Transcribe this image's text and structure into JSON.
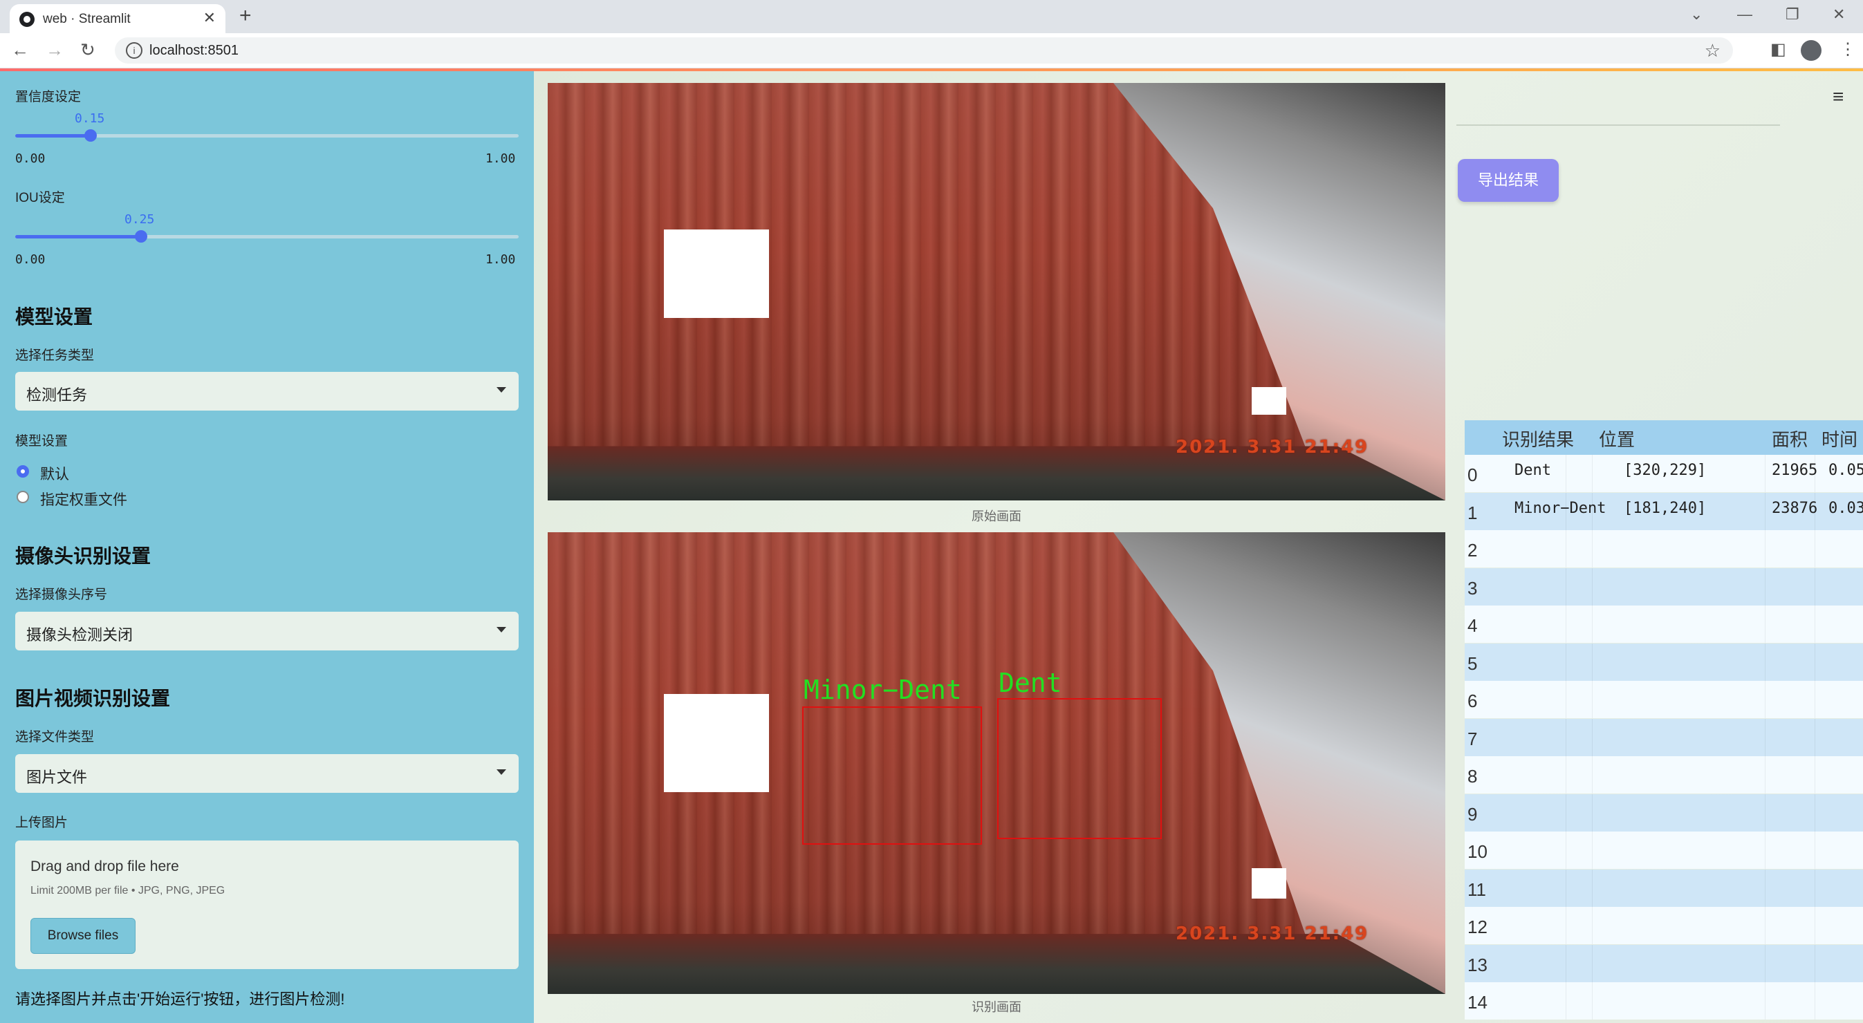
{
  "browser": {
    "tab_title": "web · Streamlit",
    "url": "localhost:8501"
  },
  "sidebar": {
    "confidence": {
      "label": "置信度设定",
      "value": "0.15",
      "min": "0.00",
      "max": "1.00",
      "fraction": 0.15
    },
    "iou": {
      "label": "IOU设定",
      "value": "0.25",
      "min": "0.00",
      "max": "1.00",
      "fraction": 0.25
    },
    "model_section": {
      "title": "模型设置",
      "task_label": "选择任务类型",
      "task_value": "检测任务",
      "model_label": "模型设置",
      "options": [
        "默认",
        "指定权重文件"
      ],
      "selected": 0
    },
    "camera_section": {
      "title": "摄像头识别设置",
      "camera_label": "选择摄像头序号",
      "camera_value": "摄像头检测关闭"
    },
    "media_section": {
      "title": "图片视频识别设置",
      "file_type_label": "选择文件类型",
      "file_type_value": "图片文件",
      "upload_label": "上传图片",
      "drop_title": "Drag and drop file here",
      "drop_limit": "Limit 200MB per file • JPG, PNG, JPEG",
      "browse_label": "Browse files"
    },
    "hint": "请选择图片并点击'开始运行'按钮，进行图片检测!"
  },
  "main": {
    "original_caption": "原始画面",
    "result_caption": "识别画面",
    "timestamp": "2021. 3.31  21:49",
    "detections": [
      {
        "label": "Minor−Dent"
      },
      {
        "label": "Dent"
      }
    ],
    "export_label": "导出结果"
  },
  "results_table": {
    "headers": [
      "识别结果",
      "位置",
      "面积",
      "时间"
    ],
    "rows": [
      {
        "index": "0",
        "result": "Dent",
        "position": "[320,229]",
        "area": "21965",
        "time": "0.05"
      },
      {
        "index": "1",
        "result": "Minor−Dent",
        "position": "[181,240]",
        "area": "23876",
        "time": "0.03"
      },
      {
        "index": "2",
        "result": "",
        "position": "",
        "area": "",
        "time": ""
      },
      {
        "index": "3",
        "result": "",
        "position": "",
        "area": "",
        "time": ""
      },
      {
        "index": "4",
        "result": "",
        "position": "",
        "area": "",
        "time": ""
      },
      {
        "index": "5",
        "result": "",
        "position": "",
        "area": "",
        "time": ""
      },
      {
        "index": "6",
        "result": "",
        "position": "",
        "area": "",
        "time": ""
      },
      {
        "index": "7",
        "result": "",
        "position": "",
        "area": "",
        "time": ""
      },
      {
        "index": "8",
        "result": "",
        "position": "",
        "area": "",
        "time": ""
      },
      {
        "index": "9",
        "result": "",
        "position": "",
        "area": "",
        "time": ""
      },
      {
        "index": "10",
        "result": "",
        "position": "",
        "area": "",
        "time": ""
      },
      {
        "index": "11",
        "result": "",
        "position": "",
        "area": "",
        "time": ""
      },
      {
        "index": "12",
        "result": "",
        "position": "",
        "area": "",
        "time": ""
      },
      {
        "index": "13",
        "result": "",
        "position": "",
        "area": "",
        "time": ""
      },
      {
        "index": "14",
        "result": "",
        "position": "",
        "area": "",
        "time": ""
      }
    ]
  },
  "colors": {
    "sidebar_bg": "#7cc6da",
    "accent": "#4a6cf0",
    "export_button": "#8f8cf0",
    "detection_box": "#e01010",
    "detection_label": "#22e022"
  }
}
